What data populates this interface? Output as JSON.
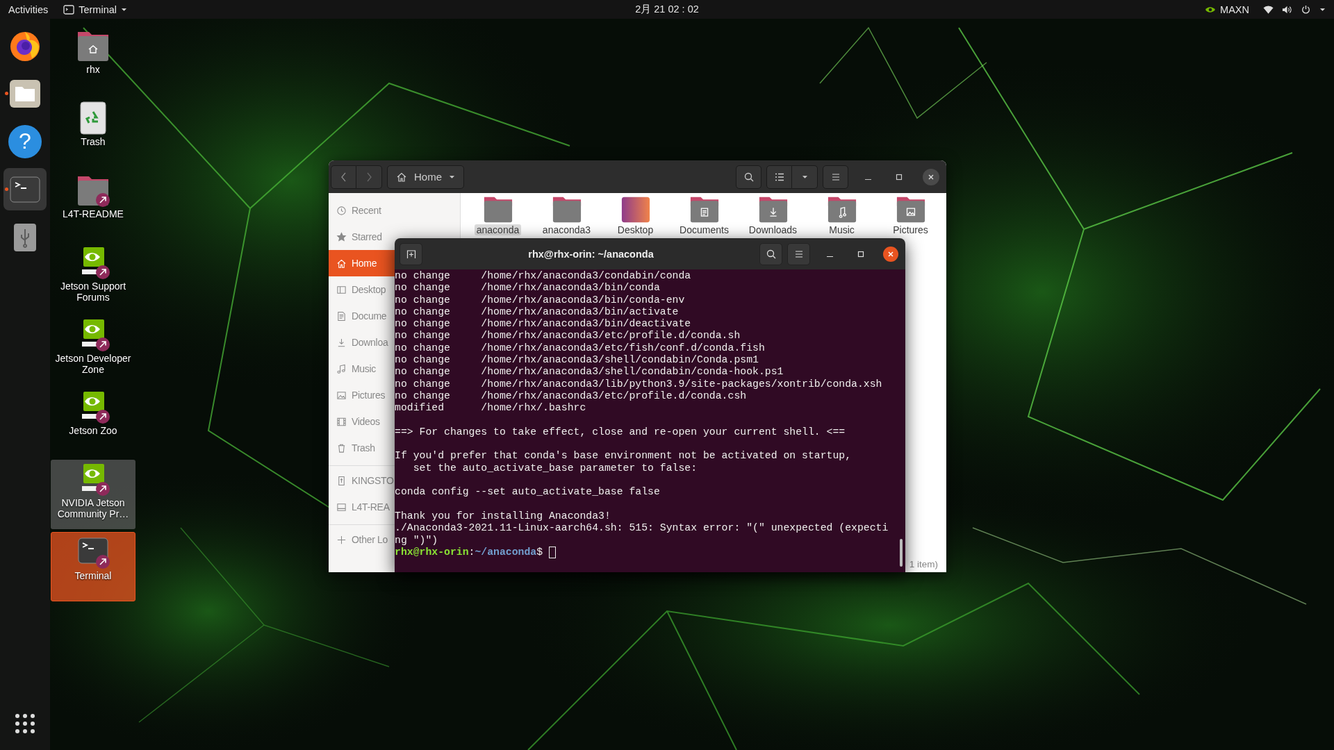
{
  "top_bar": {
    "activities": "Activities",
    "app_menu": "Terminal",
    "clock": "2月 21  02 : 02",
    "power_mode": "MAXN"
  },
  "dock": [
    {
      "kind": "firefox",
      "running": false,
      "active": false
    },
    {
      "kind": "files",
      "running": true,
      "active": false
    },
    {
      "kind": "help",
      "glyph": "?",
      "running": false,
      "active": false
    },
    {
      "kind": "terminal",
      "running": true,
      "active": true
    },
    {
      "kind": "usb",
      "running": false,
      "active": false
    }
  ],
  "desktop_icons": [
    {
      "kind": "home-folder",
      "label": "rhx",
      "selected": false,
      "hovered": false
    },
    {
      "kind": "trash",
      "label": "Trash",
      "selected": false,
      "hovered": false
    },
    {
      "kind": "folder-link",
      "label": "L4T-README",
      "selected": false,
      "hovered": false
    },
    {
      "kind": "nvidia-link",
      "label": "Jetson Support Forums",
      "selected": false,
      "hovered": false
    },
    {
      "kind": "nvidia-link",
      "label": "Jetson Developer Zone",
      "selected": false,
      "hovered": false
    },
    {
      "kind": "nvidia-link",
      "label": "Jetson Zoo",
      "selected": false,
      "hovered": false
    },
    {
      "kind": "nvidia-link",
      "label": "NVIDIA Jetson Community Pr…",
      "selected": false,
      "hovered": true
    },
    {
      "kind": "terminal-link",
      "label": "Terminal",
      "selected": true,
      "hovered": false
    }
  ],
  "files_window": {
    "path": "Home",
    "sidebar_sections": [
      {
        "items": [
          {
            "kind": "recent",
            "label": "Recent",
            "selected": false
          },
          {
            "kind": "starred",
            "label": "Starred",
            "selected": false
          },
          {
            "kind": "home",
            "label": "Home",
            "selected": true
          },
          {
            "kind": "desktop",
            "label": "Desktop",
            "selected": false
          },
          {
            "kind": "documents",
            "label": "Docume",
            "selected": false
          },
          {
            "kind": "downloads",
            "label": "Downloa",
            "selected": false
          },
          {
            "kind": "music",
            "label": "Music",
            "selected": false
          },
          {
            "kind": "pictures",
            "label": "Pictures",
            "selected": false
          },
          {
            "kind": "videos",
            "label": "Videos",
            "selected": false
          },
          {
            "kind": "trash",
            "label": "Trash",
            "selected": false
          }
        ]
      },
      {
        "items": [
          {
            "kind": "usb",
            "label": "KINGSTO",
            "selected": false
          },
          {
            "kind": "drive",
            "label": "L4T-REA",
            "selected": false
          }
        ]
      },
      {
        "items": [
          {
            "kind": "other",
            "label": "Other Lo",
            "selected": false
          }
        ]
      }
    ],
    "folders": [
      {
        "kind": "plain",
        "label": "anaconda",
        "selected": true
      },
      {
        "kind": "plain",
        "label": "anaconda3",
        "selected": false
      },
      {
        "kind": "desktop",
        "label": "Desktop",
        "selected": false
      },
      {
        "kind": "documents",
        "label": "Documents",
        "selected": false
      },
      {
        "kind": "downloads",
        "label": "Downloads",
        "selected": false
      },
      {
        "kind": "music",
        "label": "Music",
        "selected": false
      },
      {
        "kind": "pictures",
        "label": "Pictures",
        "selected": false
      }
    ],
    "status": "1 item)"
  },
  "terminal": {
    "title": "rhx@rhx-orin: ~/anaconda",
    "blocks": [
      [
        "no change     /home/rhx/anaconda3/condabin/conda",
        "no change     /home/rhx/anaconda3/bin/conda",
        "no change     /home/rhx/anaconda3/bin/conda-env",
        "no change     /home/rhx/anaconda3/bin/activate",
        "no change     /home/rhx/anaconda3/bin/deactivate",
        "no change     /home/rhx/anaconda3/etc/profile.d/conda.sh",
        "no change     /home/rhx/anaconda3/etc/fish/conf.d/conda.fish",
        "no change     /home/rhx/anaconda3/shell/condabin/Conda.psm1",
        "no change     /home/rhx/anaconda3/shell/condabin/conda-hook.ps1",
        "no change     /home/rhx/anaconda3/lib/python3.9/site-packages/xontrib/conda.xsh",
        "no change     /home/rhx/anaconda3/etc/profile.d/conda.csh",
        "modified      /home/rhx/.bashrc"
      ],
      [
        "==> For changes to take effect, close and re-open your current shell. <=="
      ],
      [
        "If you'd prefer that conda's base environment not be activated on startup,",
        "   set the auto_activate_base parameter to false:"
      ],
      [
        "conda config --set auto_activate_base false"
      ],
      [
        "Thank you for installing Anaconda3!",
        "./Anaconda3-2021.11-Linux-aarch64.sh: 515: Syntax error: \"(\" unexpected (expecti",
        "ng \")\")"
      ]
    ],
    "prompt": {
      "user_host": "rhx@rhx-orin",
      "separator": ":",
      "path": "~/anaconda",
      "symbol": "$ "
    }
  }
}
